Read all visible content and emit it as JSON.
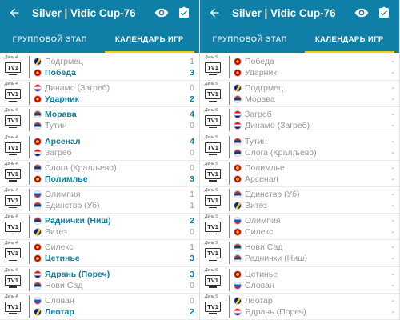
{
  "screens": [
    {
      "title": "Silver | Vidic Cup-76",
      "tabs": [
        "ГРУППОВОЙ ЭТАП",
        "КАЛЕНДАРЬ ИГР"
      ],
      "active_tab": 1,
      "matches": [
        {
          "day": "День 4",
          "tv": "TV1",
          "home": {
            "name": "Подгрмец",
            "score": "1",
            "win": false,
            "flag": "bih"
          },
          "away": {
            "name": "Победа",
            "score": "3",
            "win": true,
            "flag": "mkd"
          }
        },
        {
          "day": "День 4",
          "tv": "TV1",
          "home": {
            "name": "Динамо (Загреб)",
            "score": "0",
            "win": false,
            "flag": "cro"
          },
          "away": {
            "name": "Ударник",
            "score": "2",
            "win": true,
            "flag": "mkd"
          }
        },
        {
          "day": "День 4",
          "tv": "TV1",
          "home": {
            "name": "Морава",
            "score": "4",
            "win": true,
            "flag": "srb"
          },
          "away": {
            "name": "Тутин",
            "score": "0",
            "win": false,
            "flag": "srb"
          }
        },
        {
          "day": "День 4",
          "tv": "TV1",
          "home": {
            "name": "Арсенал",
            "score": "4",
            "win": true,
            "flag": "mne"
          },
          "away": {
            "name": "Загреб",
            "score": "0",
            "win": false,
            "flag": "cro"
          }
        },
        {
          "day": "День 4",
          "tv": "TV1",
          "home": {
            "name": "Слога (Кралљево)",
            "score": "0",
            "win": false,
            "flag": "srb"
          },
          "away": {
            "name": "Полимлье",
            "score": "3",
            "win": true,
            "flag": "mne"
          }
        },
        {
          "day": "День 4",
          "tv": "TV1",
          "home": {
            "name": "Олимпия",
            "score": "1",
            "win": false,
            "flag": "svn"
          },
          "away": {
            "name": "Единство (Уб)",
            "score": "1",
            "win": false,
            "flag": "srb"
          }
        },
        {
          "day": "День 4",
          "tv": "TV1",
          "home": {
            "name": "Раднички (Ниш)",
            "score": "2",
            "win": true,
            "flag": "srb"
          },
          "away": {
            "name": "Витез",
            "score": "0",
            "win": false,
            "flag": "bih"
          }
        },
        {
          "day": "День 4",
          "tv": "TV1",
          "home": {
            "name": "Силекс",
            "score": "1",
            "win": false,
            "flag": "mkd"
          },
          "away": {
            "name": "Цетинье",
            "score": "3",
            "win": true,
            "flag": "mne"
          }
        },
        {
          "day": "День 4",
          "tv": "TV1",
          "home": {
            "name": "Ядрань (Пореч)",
            "score": "3",
            "win": true,
            "flag": "cro"
          },
          "away": {
            "name": "Нови Сад",
            "score": "0",
            "win": false,
            "flag": "srb"
          }
        },
        {
          "day": "День 4",
          "tv": "TV1",
          "home": {
            "name": "Слован",
            "score": "0",
            "win": false,
            "flag": "svn"
          },
          "away": {
            "name": "Леотар",
            "score": "2",
            "win": true,
            "flag": "bih"
          }
        }
      ]
    },
    {
      "title": "Silver | Vidic Cup-76",
      "tabs": [
        "ГРУППОВОЙ ЭТАП",
        "КАЛЕНДАРЬ ИГР"
      ],
      "active_tab": 1,
      "matches": [
        {
          "day": "День 5",
          "tv": "TV1",
          "home": {
            "name": "Победа",
            "score": "-",
            "win": false,
            "flag": "mkd"
          },
          "away": {
            "name": "Ударник",
            "score": "-",
            "win": false,
            "flag": "mkd"
          }
        },
        {
          "day": "День 5",
          "tv": "TV1",
          "home": {
            "name": "Подгрмец",
            "score": "-",
            "win": false,
            "flag": "bih"
          },
          "away": {
            "name": "Морава",
            "score": "-",
            "win": false,
            "flag": "srb"
          }
        },
        {
          "day": "День 5",
          "tv": "TV1",
          "home": {
            "name": "Загреб",
            "score": "-",
            "win": false,
            "flag": "cro"
          },
          "away": {
            "name": "Динамо (Загреб)",
            "score": "-",
            "win": false,
            "flag": "cro"
          }
        },
        {
          "day": "День 5",
          "tv": "TV1",
          "home": {
            "name": "Тутин",
            "score": "-",
            "win": false,
            "flag": "srb"
          },
          "away": {
            "name": "Слога (Кралљево)",
            "score": "-",
            "win": false,
            "flag": "srb"
          }
        },
        {
          "day": "День 5",
          "tv": "TV1",
          "home": {
            "name": "Полимлье",
            "score": "-",
            "win": false,
            "flag": "mne"
          },
          "away": {
            "name": "Арсенал",
            "score": "-",
            "win": false,
            "flag": "mne"
          }
        },
        {
          "day": "День 5",
          "tv": "TV1",
          "home": {
            "name": "Единство (Уб)",
            "score": "-",
            "win": false,
            "flag": "srb"
          },
          "away": {
            "name": "Витез",
            "score": "-",
            "win": false,
            "flag": "bih"
          }
        },
        {
          "day": "День 5",
          "tv": "TV1",
          "home": {
            "name": "Олимпия",
            "score": "-",
            "win": false,
            "flag": "svn"
          },
          "away": {
            "name": "Силекс",
            "score": "-",
            "win": false,
            "flag": "mkd"
          }
        },
        {
          "day": "День 5",
          "tv": "TV1",
          "home": {
            "name": "Нови Сад",
            "score": "-",
            "win": false,
            "flag": "srb"
          },
          "away": {
            "name": "Раднички (Ниш)",
            "score": "-",
            "win": false,
            "flag": "srb"
          }
        },
        {
          "day": "День 5",
          "tv": "TV1",
          "home": {
            "name": "Цетинье",
            "score": "-",
            "win": false,
            "flag": "mne"
          },
          "away": {
            "name": "Слован",
            "score": "-",
            "win": false,
            "flag": "svn"
          }
        },
        {
          "day": "День 5",
          "tv": "TV1",
          "home": {
            "name": "Леотар",
            "score": "-",
            "win": false,
            "flag": "bih"
          },
          "away": {
            "name": "Ядрань (Пореч)",
            "score": "-",
            "win": false,
            "flag": "cro"
          }
        }
      ]
    }
  ],
  "icons": {
    "back": "arrow-back-icon",
    "view": "eye-icon",
    "done": "clipboard-check-icon"
  },
  "colors": {
    "appbar": "#0f7fa8",
    "accent_indicator": "#ffcc00",
    "win_text": "#0f7fa8",
    "muted_text": "#999999"
  }
}
